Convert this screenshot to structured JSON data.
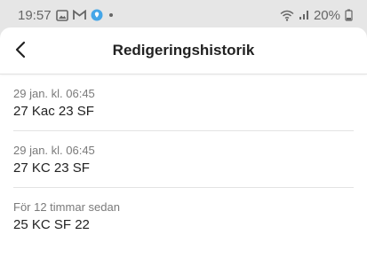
{
  "status_bar": {
    "time": "19:57",
    "battery": "20%",
    "icons": [
      "image-icon",
      "gmail-icon",
      "location-pin-icon",
      "dot-icon",
      "wifi-icon",
      "signal-icon",
      "battery-icon"
    ]
  },
  "header": {
    "title": "Redigeringshistorik",
    "back_icon": "chevron-left-icon"
  },
  "edits": [
    {
      "time": "29 jan. kl. 06:45",
      "text": "27 Kac 23 SF"
    },
    {
      "time": "29 jan. kl. 06:45",
      "text": "27 KC 23 SF"
    },
    {
      "time": "För 12 timmar sedan",
      "text": "25 KC SF 22"
    }
  ],
  "colors": {
    "background": "#e6e6e6",
    "sheet": "#ffffff",
    "title": "#222222",
    "secondary_text": "#7a7a7a",
    "status_pin": "#45a6e8"
  }
}
